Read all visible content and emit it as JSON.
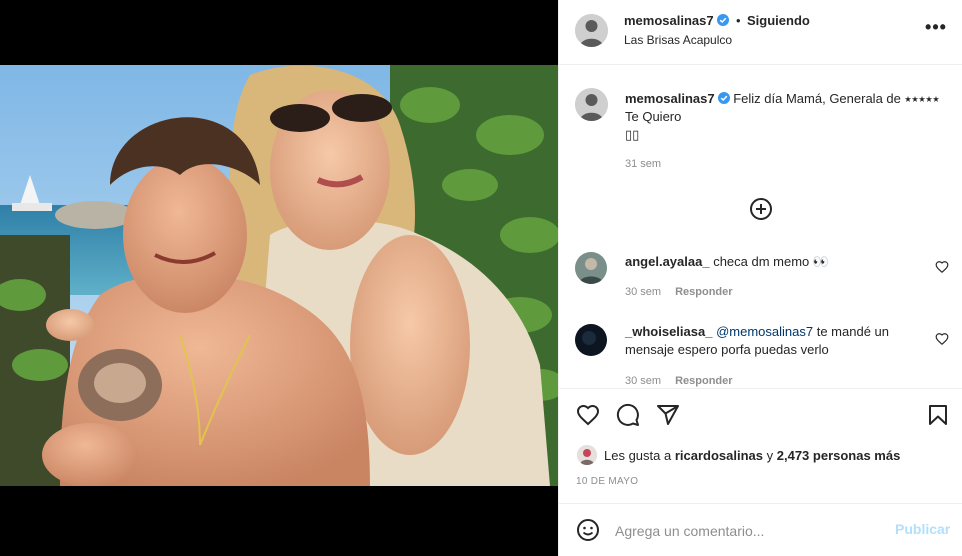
{
  "header": {
    "username": "memosalinas7",
    "separator": "•",
    "follow_status": "Siguiendo",
    "location": "Las Brisas Acapulco",
    "more_label": "•••"
  },
  "caption": {
    "username": "memosalinas7",
    "text": "Feliz día Mamá, Generala de ⭑⭑⭑⭑⭑ Te Quiero",
    "emoji_line": "▯▯",
    "time": "31 sem"
  },
  "comments": [
    {
      "username": "angel.ayalaa_",
      "text": "checa dm memo 👀",
      "time": "30 sem",
      "reply_label": "Responder"
    },
    {
      "username": "_whoiseliasa_",
      "mention": "@memosalinas7",
      "text": "te mandé un mensaje espero porfa puedas verlo",
      "time": "30 sem",
      "reply_label": "Responder"
    }
  ],
  "likes": {
    "prefix": "Les gusta a",
    "user": "ricardosalinas",
    "connector": "y",
    "count_text": "2,473 personas más"
  },
  "date": "10 DE MAYO",
  "comment_box": {
    "placeholder": "Agrega un comentario...",
    "post_label": "Publicar"
  },
  "colors": {
    "verified": "#3897f0",
    "muted": "#8e8e8e",
    "publish_disabled": "#b2dffc",
    "mention": "#00376b"
  },
  "icons": [
    "verified-badge-icon",
    "more-options-icon",
    "load-more-icon",
    "heart-icon",
    "comment-icon",
    "share-icon",
    "bookmark-icon",
    "emoji-icon"
  ]
}
